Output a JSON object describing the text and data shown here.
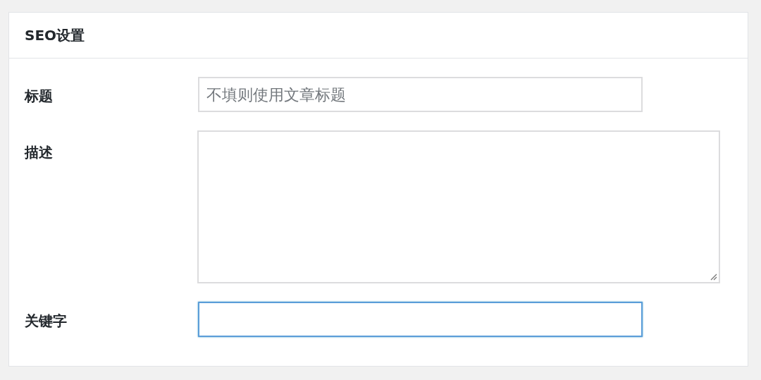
{
  "panel": {
    "title": "SEO设置"
  },
  "fields": [
    {
      "kind": "input",
      "label": "标题",
      "placeholder": "不填则使用文章标题",
      "focused": false
    },
    {
      "kind": "textarea",
      "label": "描述",
      "focused": false
    },
    {
      "kind": "input",
      "label": "关键字",
      "focused": true
    }
  ]
}
